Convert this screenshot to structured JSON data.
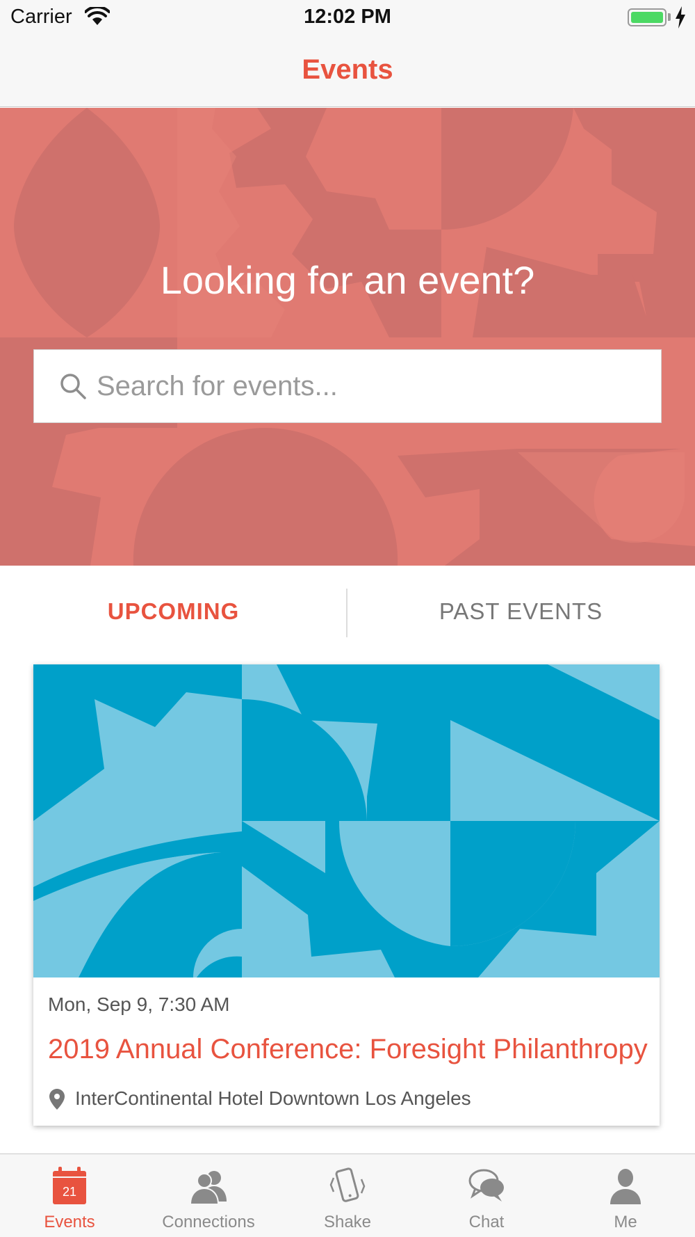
{
  "status_bar": {
    "carrier": "Carrier",
    "time": "12:02 PM"
  },
  "nav": {
    "title": "Events"
  },
  "hero": {
    "title": "Looking for an event?",
    "search_placeholder": "Search for events..."
  },
  "tabs": [
    {
      "label": "UPCOMING",
      "selected": true
    },
    {
      "label": "PAST EVENTS",
      "selected": false
    }
  ],
  "event": {
    "date": "Mon, Sep 9, 7:30 AM",
    "title": "2019 Annual Conference: Foresight Philanthropy",
    "location": "InterContinental Hotel Downtown Los Angeles"
  },
  "tab_bar": {
    "calendar_day": "21",
    "items": [
      {
        "label": "Events",
        "icon": "calendar-icon",
        "active": true
      },
      {
        "label": "Connections",
        "icon": "people-icon",
        "active": false
      },
      {
        "label": "Shake",
        "icon": "phone-shake-icon",
        "active": false
      },
      {
        "label": "Chat",
        "icon": "chat-bubbles-icon",
        "active": false
      },
      {
        "label": "Me",
        "icon": "person-icon",
        "active": false
      }
    ]
  },
  "colors": {
    "accent": "#e8533f",
    "hero_bg": "#e07a72",
    "card_image_dark": "#00a0c9",
    "card_image_light": "#74c8e2"
  }
}
